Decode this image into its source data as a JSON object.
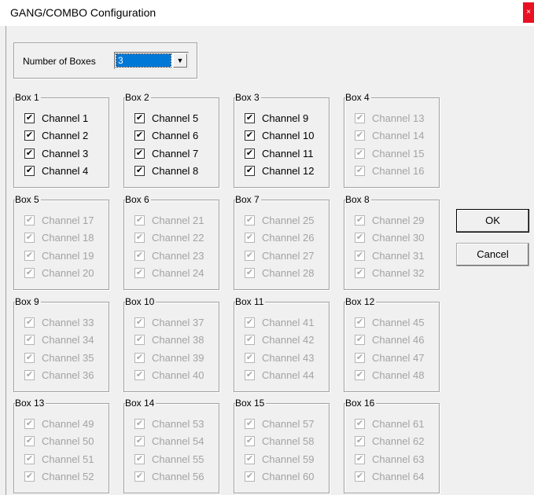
{
  "window": {
    "title": "GANG/COMBO Configuration",
    "close_glyph": "×"
  },
  "number_of_boxes": {
    "label": "Number of Boxes",
    "value": "3",
    "dropdown_glyph": "▼"
  },
  "checkmark_glyph": "✔",
  "boxes": [
    {
      "label": "Box 1",
      "enabled": true,
      "channels": [
        {
          "label": "Channel 1",
          "checked": true
        },
        {
          "label": "Channel 2",
          "checked": true
        },
        {
          "label": "Channel 3",
          "checked": true
        },
        {
          "label": "Channel 4",
          "checked": true
        }
      ]
    },
    {
      "label": "Box 2",
      "enabled": true,
      "channels": [
        {
          "label": "Channel 5",
          "checked": true
        },
        {
          "label": "Channel 6",
          "checked": true
        },
        {
          "label": "Channel 7",
          "checked": true
        },
        {
          "label": "Channel 8",
          "checked": true
        }
      ]
    },
    {
      "label": "Box 3",
      "enabled": true,
      "channels": [
        {
          "label": "Channel 9",
          "checked": true
        },
        {
          "label": "Channel 10",
          "checked": true
        },
        {
          "label": "Channel 11",
          "checked": true
        },
        {
          "label": "Channel 12",
          "checked": true
        }
      ]
    },
    {
      "label": "Box 4",
      "enabled": false,
      "channels": [
        {
          "label": "Channel 13",
          "checked": true
        },
        {
          "label": "Channel 14",
          "checked": true
        },
        {
          "label": "Channel 15",
          "checked": true
        },
        {
          "label": "Channel 16",
          "checked": true
        }
      ]
    },
    {
      "label": "Box 5",
      "enabled": false,
      "channels": [
        {
          "label": "Channel 17",
          "checked": true
        },
        {
          "label": "Channel 18",
          "checked": true
        },
        {
          "label": "Channel 19",
          "checked": true
        },
        {
          "label": "Channel 20",
          "checked": true
        }
      ]
    },
    {
      "label": "Box 6",
      "enabled": false,
      "channels": [
        {
          "label": "Channel 21",
          "checked": true
        },
        {
          "label": "Channel 22",
          "checked": true
        },
        {
          "label": "Channel 23",
          "checked": true
        },
        {
          "label": "Channel 24",
          "checked": true
        }
      ]
    },
    {
      "label": "Box 7",
      "enabled": false,
      "channels": [
        {
          "label": "Channel 25",
          "checked": true
        },
        {
          "label": "Channel 26",
          "checked": true
        },
        {
          "label": "Channel 27",
          "checked": true
        },
        {
          "label": "Channel 28",
          "checked": true
        }
      ]
    },
    {
      "label": "Box 8",
      "enabled": false,
      "channels": [
        {
          "label": "Channel 29",
          "checked": true
        },
        {
          "label": "Channel 30",
          "checked": true
        },
        {
          "label": "Channel 31",
          "checked": true
        },
        {
          "label": "Channel 32",
          "checked": true
        }
      ]
    },
    {
      "label": "Box 9",
      "enabled": false,
      "channels": [
        {
          "label": "Channel 33",
          "checked": true
        },
        {
          "label": "Channel 34",
          "checked": true
        },
        {
          "label": "Channel 35",
          "checked": true
        },
        {
          "label": "Channel 36",
          "checked": true
        }
      ]
    },
    {
      "label": "Box 10",
      "enabled": false,
      "channels": [
        {
          "label": "Channel 37",
          "checked": true
        },
        {
          "label": "Channel 38",
          "checked": true
        },
        {
          "label": "Channel 39",
          "checked": true
        },
        {
          "label": "Channel 40",
          "checked": true
        }
      ]
    },
    {
      "label": "Box 11",
      "enabled": false,
      "channels": [
        {
          "label": "Channel 41",
          "checked": true
        },
        {
          "label": "Channel 42",
          "checked": true
        },
        {
          "label": "Channel 43",
          "checked": true
        },
        {
          "label": "Channel 44",
          "checked": true
        }
      ]
    },
    {
      "label": "Box 12",
      "enabled": false,
      "channels": [
        {
          "label": "Channel 45",
          "checked": true
        },
        {
          "label": "Channel 46",
          "checked": true
        },
        {
          "label": "Channel 47",
          "checked": true
        },
        {
          "label": "Channel 48",
          "checked": true
        }
      ]
    },
    {
      "label": "Box 13",
      "enabled": false,
      "channels": [
        {
          "label": "Channel 49",
          "checked": true
        },
        {
          "label": "Channel 50",
          "checked": true
        },
        {
          "label": "Channel 51",
          "checked": true
        },
        {
          "label": "Channel 52",
          "checked": true
        }
      ]
    },
    {
      "label": "Box 14",
      "enabled": false,
      "channels": [
        {
          "label": "Channel 53",
          "checked": true
        },
        {
          "label": "Channel 54",
          "checked": true
        },
        {
          "label": "Channel 55",
          "checked": true
        },
        {
          "label": "Channel 56",
          "checked": true
        }
      ]
    },
    {
      "label": "Box 15",
      "enabled": false,
      "channels": [
        {
          "label": "Channel 57",
          "checked": true
        },
        {
          "label": "Channel 58",
          "checked": true
        },
        {
          "label": "Channel 59",
          "checked": true
        },
        {
          "label": "Channel 60",
          "checked": true
        }
      ]
    },
    {
      "label": "Box 16",
      "enabled": false,
      "channels": [
        {
          "label": "Channel 61",
          "checked": true
        },
        {
          "label": "Channel 62",
          "checked": true
        },
        {
          "label": "Channel 63",
          "checked": true
        },
        {
          "label": "Channel 64",
          "checked": true
        }
      ]
    }
  ],
  "buttons": {
    "ok_label": "OK",
    "cancel_label": "Cancel"
  }
}
